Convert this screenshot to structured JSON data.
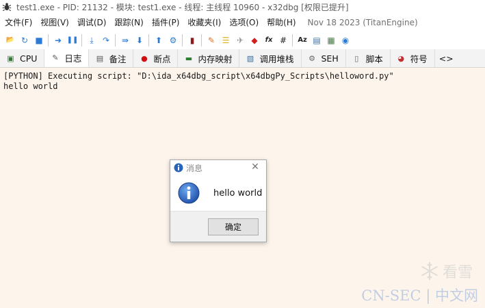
{
  "window": {
    "title": "test1.exe - PID: 21132 - 模块: test1.exe - 线程: 主线程 10960 - x32dbg [权限已提升]"
  },
  "menu": {
    "items": [
      "文件(F)",
      "视图(V)",
      "调试(D)",
      "跟踪(N)",
      "插件(P)",
      "收藏夹(I)",
      "选项(O)",
      "帮助(H)"
    ],
    "version": "Nov 18 2023 (TitanEngine)"
  },
  "toolbar": {
    "buttons": [
      {
        "icon": "open-folder-icon",
        "glyph": "📂",
        "color": "#e0a020"
      },
      {
        "icon": "restart-icon",
        "glyph": "↻",
        "color": "#2b7bd6"
      },
      {
        "icon": "stop-icon",
        "glyph": "■",
        "color": "#2b7bd6"
      },
      {
        "icon": "run-icon",
        "glyph": "➜",
        "color": "#2b7bd6"
      },
      {
        "icon": "pause-icon",
        "glyph": "❚❚",
        "color": "#2b7bd6"
      },
      {
        "icon": "step-into-icon",
        "glyph": "⤓",
        "color": "#2b7bd6"
      },
      {
        "icon": "step-over-icon",
        "glyph": "↷",
        "color": "#2b7bd6"
      },
      {
        "icon": "trace-into-icon",
        "glyph": "⇛",
        "color": "#2b7bd6"
      },
      {
        "icon": "trace-over-icon",
        "glyph": "⬇",
        "color": "#2b7bd6"
      },
      {
        "icon": "execute-till-return-icon",
        "glyph": "⬆",
        "color": "#2b7bd6"
      },
      {
        "icon": "run-to-user-code-icon",
        "glyph": "⚙",
        "color": "#2b7bd6"
      },
      {
        "icon": "scylla-icon",
        "glyph": "▮",
        "color": "#8b1a1a"
      },
      {
        "icon": "patch-icon",
        "glyph": "✎",
        "color": "#e07020"
      },
      {
        "icon": "comments-icon",
        "glyph": "☰",
        "color": "#d8b020"
      },
      {
        "icon": "labels-icon",
        "glyph": "✈",
        "color": "#909090"
      },
      {
        "icon": "bookmarks-icon",
        "glyph": "◆",
        "color": "#d02020"
      },
      {
        "icon": "functions-icon",
        "glyph": "fx",
        "color": "#222222"
      },
      {
        "icon": "variables-icon",
        "glyph": "#",
        "color": "#222222"
      },
      {
        "icon": "strings-icon",
        "glyph": "Az",
        "color": "#222222"
      },
      {
        "icon": "calls-icon",
        "glyph": "▤",
        "color": "#3a6ea5"
      },
      {
        "icon": "calculator-icon",
        "glyph": "▦",
        "color": "#4a7a4a"
      },
      {
        "icon": "help-icon",
        "glyph": "◉",
        "color": "#2b7bd6"
      }
    ]
  },
  "tabs": [
    {
      "label": "CPU",
      "icon": "cpu-icon",
      "glyph": "▣",
      "color": "#2f7d32",
      "active": false
    },
    {
      "label": "日志",
      "icon": "log-icon",
      "glyph": "✎",
      "color": "#555555",
      "active": true
    },
    {
      "label": "备注",
      "icon": "notes-icon",
      "glyph": "▤",
      "color": "#555555",
      "active": false
    },
    {
      "label": "断点",
      "icon": "breakpoints-icon",
      "glyph": "●",
      "color": "#d01010",
      "active": false
    },
    {
      "label": "内存映射",
      "icon": "memory-map-icon",
      "glyph": "▬",
      "color": "#2f7d32",
      "active": false
    },
    {
      "label": "调用堆栈",
      "icon": "call-stack-icon",
      "glyph": "▧",
      "color": "#3a6ea5",
      "active": false
    },
    {
      "label": "SEH",
      "icon": "seh-icon",
      "glyph": "⚙",
      "color": "#666666",
      "active": false
    },
    {
      "label": "脚本",
      "icon": "script-icon",
      "glyph": "▯",
      "color": "#666666",
      "active": false
    },
    {
      "label": "符号",
      "icon": "symbols-icon",
      "glyph": "◕",
      "color": "#c03030",
      "active": false
    }
  ],
  "tabs_more": "<>",
  "log": {
    "lines": [
      "[PYTHON] Executing script: \"D:\\ida_x64dbg_script\\x64dbgPy_Scripts\\helloword.py\"",
      "hello world"
    ]
  },
  "dialog": {
    "title": "消息",
    "message": "hello world",
    "ok_label": "确定"
  },
  "watermark": {
    "text": "看雪",
    "text2": "CN-SEC | 中文网"
  }
}
